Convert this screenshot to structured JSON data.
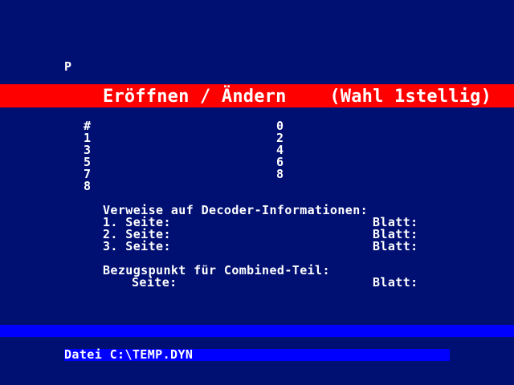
{
  "header": {
    "mode_indicator": "P"
  },
  "title": {
    "text": "Eröffnen / Ändern    (Wahl 1stellig)"
  },
  "options": {
    "left": [
      "#",
      "1",
      "3",
      "5",
      "7",
      "8"
    ],
    "right": [
      "0",
      "2",
      "4",
      "6",
      "8"
    ]
  },
  "decoder": {
    "heading": "Verweise auf Decoder-Informationen:",
    "rows": [
      {
        "label": "1. Seite:",
        "blatt_label": "Blatt:"
      },
      {
        "label": "2. Seite:",
        "blatt_label": "Blatt:"
      },
      {
        "label": "3. Seite:",
        "blatt_label": "Blatt:"
      }
    ]
  },
  "combined": {
    "heading": "Bezugspunkt für Combined-Teil:",
    "seite_label": "Seite:",
    "blatt_label": "Blatt:"
  },
  "status": {
    "file_label": "Datei C:\\TEMP.DYN"
  },
  "colors": {
    "background": "#000f72",
    "title_bar": "#ff0000",
    "divider": "#0000ff",
    "status_bar": "#0000ff",
    "text": "#ffffff"
  }
}
